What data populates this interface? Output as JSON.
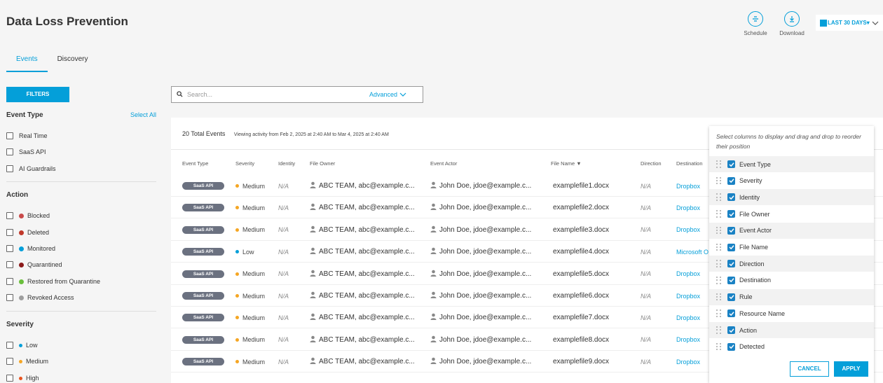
{
  "header": {
    "title": "Data Loss Prevention",
    "schedule_label": "Schedule",
    "download_label": "Download",
    "date_range_label": "LAST 30 DAYS▾"
  },
  "tabs": [
    {
      "label": "Events",
      "active": true
    },
    {
      "label": "Discovery",
      "active": false
    }
  ],
  "sidebar": {
    "filters_button": "FILTERS",
    "event_type": {
      "heading": "Event Type",
      "select_all": "Select All",
      "options": [
        "Real Time",
        "SaaS API",
        "AI Guardrails"
      ]
    },
    "action": {
      "heading": "Action",
      "options": [
        {
          "label": "Blocked",
          "color": "#c94a4a"
        },
        {
          "label": "Deleted",
          "color": "#c0392b"
        },
        {
          "label": "Monitored",
          "color": "#049fd9"
        },
        {
          "label": "Quarantined",
          "color": "#8b1a1a"
        },
        {
          "label": "Restored from Quarantine",
          "color": "#6abf3c"
        },
        {
          "label": "Revoked Access",
          "color": "#9e9e9e"
        }
      ]
    },
    "severity": {
      "heading": "Severity",
      "options": [
        {
          "label": "Low",
          "color": "#049fd9"
        },
        {
          "label": "Medium",
          "color": "#f5a623"
        },
        {
          "label": "High",
          "color": "#e8531f"
        }
      ]
    }
  },
  "search": {
    "placeholder": "Search...",
    "advanced_label": "Advanced"
  },
  "table": {
    "total_events": "20 Total Events",
    "viewing_text": "Viewing activity from Feb 2, 2025 at 2:40 AM to Mar 4, 2025 at 2:40 AM",
    "columns": [
      "Event Type",
      "Severity",
      "Identity",
      "File Owner",
      "Event Actor",
      "File Name ▼",
      "Direction",
      "Destination"
    ],
    "rows": [
      {
        "event_type": "SaaS API",
        "severity": "Medium",
        "severity_color": "#f5a623",
        "identity": "N/A",
        "file_owner": "ABC TEAM, abc@example.c...",
        "event_actor": "John Doe, jdoe@example.c...",
        "file_name": "examplefile1.docx",
        "direction": "N/A",
        "destination": "Dropbox"
      },
      {
        "event_type": "SaaS API",
        "severity": "Medium",
        "severity_color": "#f5a623",
        "identity": "N/A",
        "file_owner": "ABC TEAM, abc@example.c...",
        "event_actor": "John Doe, jdoe@example.c...",
        "file_name": "examplefile2.docx",
        "direction": "N/A",
        "destination": "Dropbox"
      },
      {
        "event_type": "SaaS API",
        "severity": "Medium",
        "severity_color": "#f5a623",
        "identity": "N/A",
        "file_owner": "ABC TEAM, abc@example.c...",
        "event_actor": "John Doe, jdoe@example.c...",
        "file_name": "examplefile3.docx",
        "direction": "N/A",
        "destination": "Dropbox"
      },
      {
        "event_type": "SaaS API",
        "severity": "Low",
        "severity_color": "#049fd9",
        "identity": "N/A",
        "file_owner": "ABC TEAM, abc@example.c...",
        "event_actor": "John Doe, jdoe@example.c...",
        "file_name": "examplefile4.docx",
        "direction": "N/A",
        "destination": "Microsoft O"
      },
      {
        "event_type": "SaaS API",
        "severity": "Medium",
        "severity_color": "#f5a623",
        "identity": "N/A",
        "file_owner": "ABC TEAM, abc@example.c...",
        "event_actor": "John Doe, jdoe@example.c...",
        "file_name": "examplefile5.docx",
        "direction": "N/A",
        "destination": "Dropbox"
      },
      {
        "event_type": "SaaS API",
        "severity": "Medium",
        "severity_color": "#f5a623",
        "identity": "N/A",
        "file_owner": "ABC TEAM, abc@example.c...",
        "event_actor": "John Doe, jdoe@example.c...",
        "file_name": "examplefile6.docx",
        "direction": "N/A",
        "destination": "Dropbox"
      },
      {
        "event_type": "SaaS API",
        "severity": "Medium",
        "severity_color": "#f5a623",
        "identity": "N/A",
        "file_owner": "ABC TEAM, abc@example.c...",
        "event_actor": "John Doe, jdoe@example.c...",
        "file_name": "examplefile7.docx",
        "direction": "N/A",
        "destination": "Dropbox"
      },
      {
        "event_type": "SaaS API",
        "severity": "Medium",
        "severity_color": "#f5a623",
        "identity": "N/A",
        "file_owner": "ABC TEAM, abc@example.c...",
        "event_actor": "John Doe, jdoe@example.c...",
        "file_name": "examplefile8.docx",
        "direction": "N/A",
        "destination": "Dropbox"
      },
      {
        "event_type": "SaaS API",
        "severity": "Medium",
        "severity_color": "#f5a623",
        "identity": "N/A",
        "file_owner": "ABC TEAM, abc@example.c...",
        "event_actor": "John Doe, jdoe@example.c...",
        "file_name": "examplefile9.docx",
        "direction": "N/A",
        "destination": "Dropbox"
      }
    ]
  },
  "column_chooser": {
    "description": "Select columns to display and drag and drop to reorder their position",
    "columns": [
      "Event Type",
      "Severity",
      "Identity",
      "File Owner",
      "Event Actor",
      "File Name",
      "Direction",
      "Destination",
      "Rule",
      "Resource Name",
      "Action",
      "Detected"
    ],
    "cancel_label": "CANCEL",
    "apply_label": "APPLY"
  }
}
